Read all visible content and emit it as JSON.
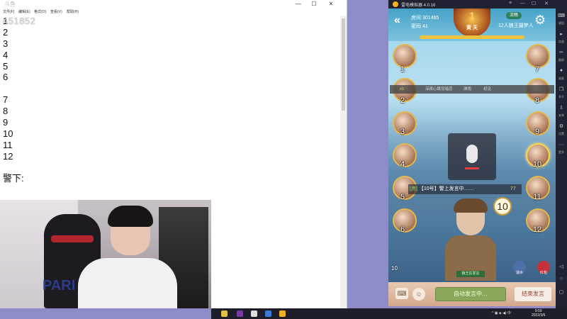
{
  "notepad": {
    "menu": [
      "文件(F)",
      "编辑(E)",
      "格式(O)",
      "查看(V)",
      "帮助(H)"
    ],
    "lines": [
      "1",
      "2",
      "3",
      "4",
      "5",
      "6",
      "",
      "7",
      "8",
      "9",
      "10",
      "11",
      "12",
      "",
      "警下:"
    ],
    "window_controls": [
      "—",
      "☐",
      "✕"
    ]
  },
  "watermark": {
    "logo": "斗鱼",
    "id": "451852"
  },
  "webcam": {
    "shirt_text": "PARI"
  },
  "emulator": {
    "title": "雷电模拟器 4.0.16",
    "window_controls": [
      "≡",
      "—",
      "☐",
      "✕"
    ],
    "sidebar": [
      "键盘",
      "加速",
      "截屏",
      "录屏",
      "多开",
      "安装",
      "设置",
      "更多"
    ]
  },
  "game": {
    "room_label": "房间 301465",
    "password_label": "密码 41",
    "badge_level": "1",
    "badge_text": "黄 天",
    "flow_badge": "流畅",
    "mode_label": "12人狼王摄梦人",
    "chat_strip": [
      "x1",
      "深夜心跳没暗恋",
      "淋雨",
      "初见"
    ],
    "speak_tag": "[房]",
    "speak_text": "【10号】警上发言中……",
    "speak_num": "77",
    "speaker_number": "10",
    "character_label": "狼王在发言",
    "counter": "10",
    "rescue_label": "退水",
    "redpacket_label": "红包",
    "auto_speak_label": "自动发言中…",
    "end_speech_label": "结束发言",
    "seat_numbers": [
      "1",
      "2",
      "3",
      "4",
      "5",
      "6",
      "7",
      "8",
      "9",
      "10",
      "11",
      "12"
    ]
  },
  "taskbar": {
    "time": "9:59",
    "date": "2022/3/6"
  }
}
